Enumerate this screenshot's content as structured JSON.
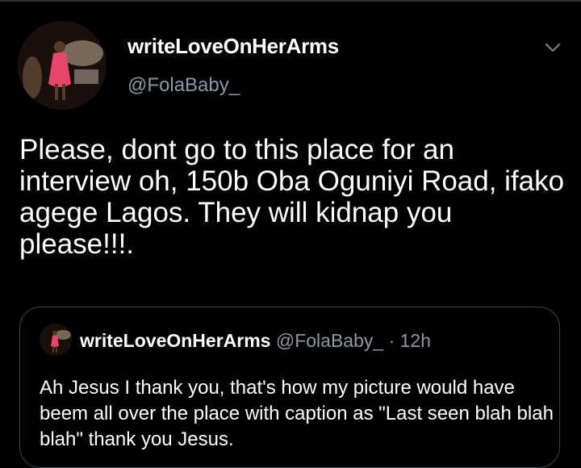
{
  "tweet": {
    "author_name": "writeLoveOnHerArms",
    "author_handle": "@FolaBaby_",
    "avatar_icon": "profile-photo",
    "caret_icon": "chevron-down-icon",
    "text": "Please, dont go to this place for an interview oh, 150b Oba Oguniyi Road, ifako agege Lagos. They will kidnap you please!!!."
  },
  "quoted_tweet": {
    "author_name": "writeLoveOnHerArms",
    "author_handle": "@FolaBaby_",
    "separator": "·",
    "time": "12h",
    "text": "Ah Jesus I thank you, that's how my picture would have beem all over the place with caption as \"Last seen blah blah blah\" thank you Jesus."
  },
  "colors": {
    "background": "#000000",
    "primary_text": "#ffffff",
    "secondary_text": "#8b98a5",
    "border": "#38444d"
  }
}
